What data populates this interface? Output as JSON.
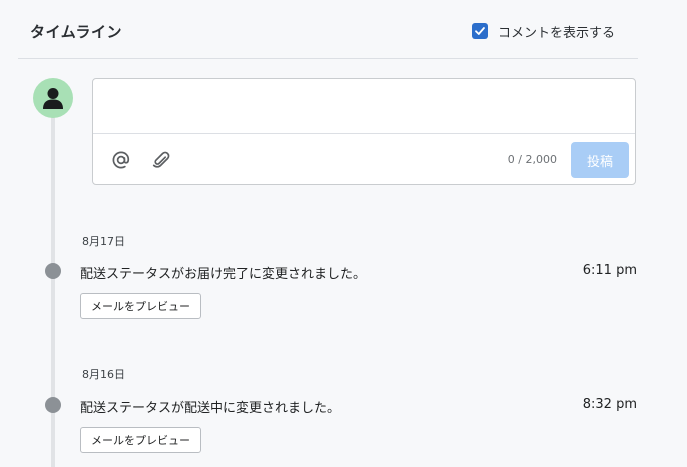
{
  "header": {
    "title": "タイムライン",
    "show_comments_label": "コメントを表示する",
    "show_comments_checked": true
  },
  "composer": {
    "value": "",
    "char_count": "0 / 2,000",
    "post_label": "投稿",
    "post_enabled": false
  },
  "events": [
    {
      "date": "8月17日",
      "text": "配送ステータスがお届け完了に変更されました。",
      "time": "6:11 pm",
      "button_label": "メールをプレビュー"
    },
    {
      "date": "8月16日",
      "text": "配送ステータスが配送中に変更されました。",
      "time": "8:32 pm",
      "button_label": "メールをプレビュー"
    }
  ],
  "colors": {
    "accent": "#2c6ecb",
    "avatar_bg": "#a8e0b5",
    "post_disabled": "#a9cdf6",
    "timeline_dot": "#8c9196"
  },
  "icons": {
    "mention": "at-sign-icon",
    "attach": "paperclip-icon",
    "avatar": "user-silhouette-icon",
    "checkbox": "checkmark-icon"
  }
}
